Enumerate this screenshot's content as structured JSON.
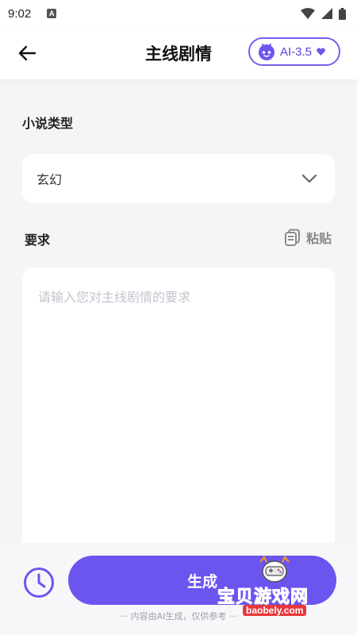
{
  "status_bar": {
    "time": "9:02",
    "notification_letter": "A",
    "icons": [
      "wifi-icon",
      "signal-icon",
      "battery-icon"
    ]
  },
  "header": {
    "title": "主线剧情",
    "model_label": "AI-3.5",
    "icons": [
      "back-arrow-icon",
      "robot-icon",
      "heart-icon"
    ]
  },
  "genre": {
    "label": "小说类型",
    "selected": "玄幻"
  },
  "requirements": {
    "label": "要求",
    "paste_label": "粘贴",
    "placeholder": "请输入您对主线剧情的要求",
    "value": ""
  },
  "footer": {
    "generate_label": "生成",
    "disclaimer": "··· 内容由AI生成，仅供参考 ···"
  },
  "watermark": {
    "text": "宝贝游戏网",
    "url": "baobely.com"
  },
  "colors": {
    "accent": "#6b55ef",
    "accent_light": "#7a5df0",
    "background": "#f5f5f7",
    "card": "#ffffff",
    "placeholder": "#c4c4d0",
    "watermark_red": "#e8383c"
  }
}
